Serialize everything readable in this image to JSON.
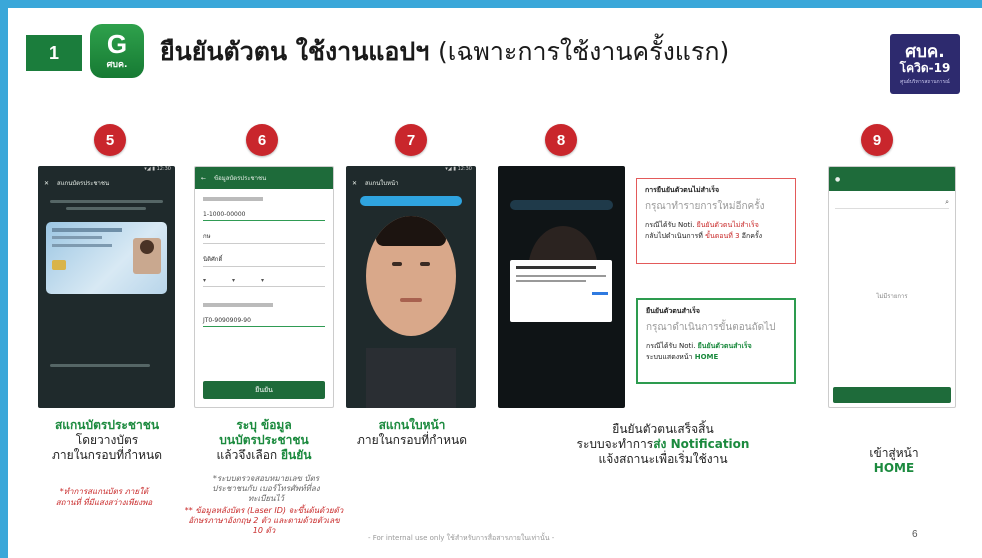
{
  "header": {
    "step_number": "1",
    "app_icon_letter": "G",
    "app_icon_text": "ศบค.",
    "title_bold": "ยืนยันตัวตน ใช้งานแอปฯ",
    "title_light": "(เฉพาะการใช้งานครั้งแรก)",
    "logo_line1": "ศบค.",
    "logo_line2": "โควิด-19",
    "logo_line3": "ศูนย์บริหารสถานการณ์"
  },
  "steps": [
    {
      "number": "5"
    },
    {
      "number": "6"
    },
    {
      "number": "7"
    },
    {
      "number": "8"
    },
    {
      "number": "9"
    }
  ],
  "captions": {
    "step5_line1": "สแกนบัตรประชาชน",
    "step5_line2": "โดยวางบัตร",
    "step5_line3": "ภายในกรอบที่กำหนด",
    "step5_note": "*ทำการสแกนบัตร ภายใต้สถานที่ ที่มีแสงสว่างเพียงพอ",
    "step6_line1": "ระบุ ข้อมูล",
    "step6_line2": "บนบัตรประชาชน",
    "step6_line3_a": "แล้วจึงเลือก ",
    "step6_line3_b": "ยืนยัน",
    "step6_note_gray": "*ระบบตรวจสอบหมายเลข บัตรประชาชนกับ เบอร์โทรศัพท์ที่ลงทะเบียนไว้",
    "step6_note_red": "** ข้อมูลหลังบัตร (Laser ID) จะขึ้นต้นด้วยตัวอักษรภาษาอังกฤษ 2 ตัว และตามด้วยตัวเลข 10 ตัว",
    "step7_line1": "สแกนใบหน้า",
    "step7_line2": "ภายในกรอบที่กำหนด",
    "step8_line1": "ยืนยันตัวตนเสร็จสิ้น",
    "step8_line2_a": "ระบบจะทำการ",
    "step8_line2_b": "ส่ง Notification",
    "step8_line3": "แจ้งสถานะเพื่อเริ่มใช้งาน",
    "step9_line1": "เข้าสู่หน้า",
    "step9_line2": "HOME"
  },
  "popup_fail": {
    "title": "การยืนยันตัวตนไม่สำเร็จ",
    "subtitle": "กรุณาทำรายการใหม่อีกครั้ง",
    "text_a": "กรณีได้รับ Noti. ",
    "text_b": "ยืนยันตัวตนไม่สำเร็จ",
    "text_c": "กลับไปดำเนินการที่ ",
    "text_d": "ขั้นตอนที่ 3",
    "text_e": " อีกครั้ง"
  },
  "popup_success": {
    "title": "ยืนยันตัวตนสำเร็จ",
    "subtitle": "กรุณาดำเนินการขั้นตอนถัดไป",
    "text_a": "กรณีได้รับ Noti. ",
    "text_b": "ยืนยันตัวตนสำเร็จ",
    "text_c": "ระบบแสดงหน้า ",
    "text_d": "HOME"
  },
  "phones": {
    "p5_title": "สแกนบัตรประชาชน",
    "p6_title": "ข้อมูลบัตรประชาชน",
    "p6_field1": "1-1000-00000",
    "p6_field2": "กษ",
    "p6_field3": "นิติศักดิ์",
    "p6_field4": "JT0-9090909-90",
    "p6_button": "ยืนยัน",
    "p7_title": "สแกนใบหน้า",
    "p9_empty": "ไม่มีรายการ"
  },
  "footer": "- For internal use only ใช้สำหรับการสื่อสารภายในเท่านั้น -",
  "page_number": "6",
  "colors": {
    "accent_blue": "#3aa7d9",
    "step_red": "#c9262c",
    "brand_green": "#1b7d3c"
  }
}
